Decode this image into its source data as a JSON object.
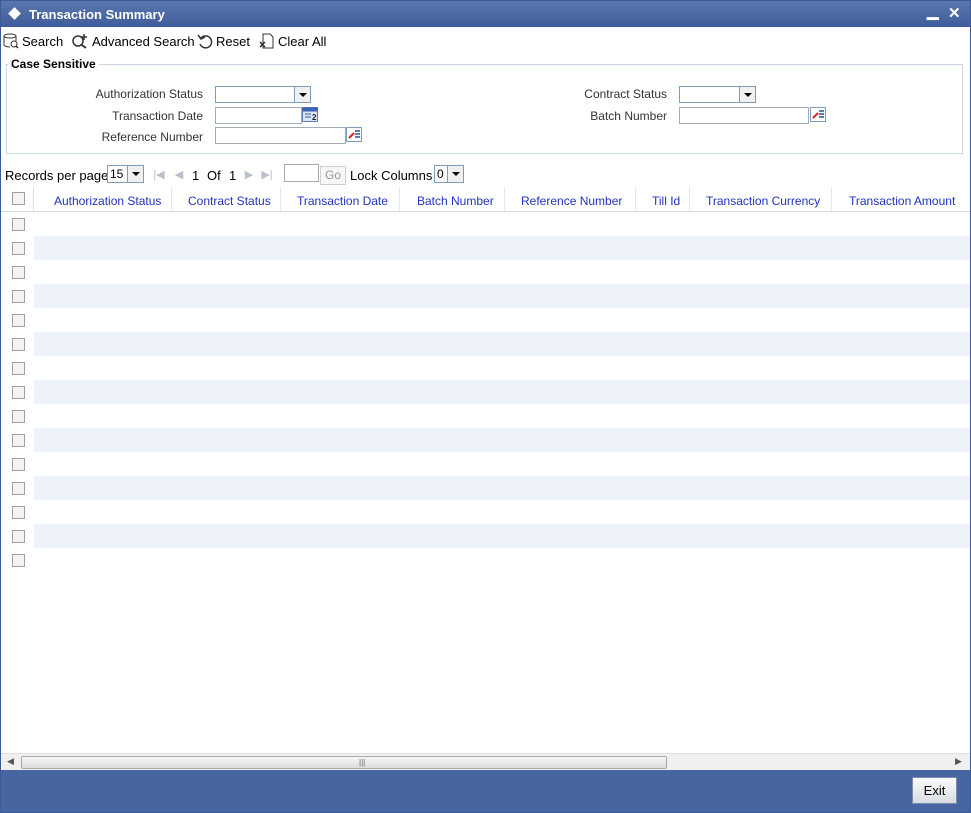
{
  "window": {
    "title": "Transaction Summary",
    "minimize_glyph": "▁",
    "close_glyph": "✕"
  },
  "toolbar": {
    "search_label": "Search",
    "advanced_search_label": "Advanced Search",
    "reset_label": "Reset",
    "clear_all_label": "Clear All"
  },
  "criteria": {
    "legend": "Case Sensitive",
    "authorization_status_label": "Authorization Status",
    "transaction_date_label": "Transaction Date",
    "reference_number_label": "Reference Number",
    "contract_status_label": "Contract Status",
    "batch_number_label": "Batch Number",
    "authorization_status_value": "",
    "contract_status_value": "",
    "transaction_date_value": "",
    "reference_number_value": "",
    "batch_number_value": ""
  },
  "pager": {
    "records_per_page_label": "Records per page",
    "records_per_page_value": "15",
    "current_page": "1",
    "of_label": "Of",
    "total_pages": "1",
    "go_label": "Go",
    "lock_columns_label": "Lock Columns",
    "lock_columns_value": "0"
  },
  "grid": {
    "columns": [
      "Authorization Status",
      "Contract Status",
      "Transaction Date",
      "Batch Number",
      "Reference Number",
      "Till Id",
      "Transaction Currency",
      "Transaction Amount"
    ],
    "empty_row_count": 15
  },
  "footer": {
    "exit_label": "Exit"
  },
  "colors": {
    "title_bar": "#4765a0",
    "column_header_text": "#2233bb",
    "stripe": "#eef3f9"
  }
}
